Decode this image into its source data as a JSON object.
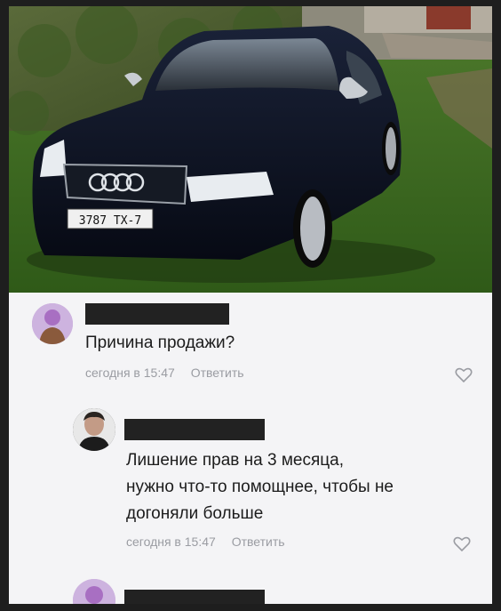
{
  "post": {
    "photo_alt_icon": "car-photo",
    "license_plate": "3787 TX-7"
  },
  "comments": [
    {
      "text": "Причина продажи?",
      "time": "сегодня в 15:47",
      "reply_label": "Ответить",
      "like_icon": "heart-outline-icon"
    },
    {
      "text_lines": [
        "Лишение прав на 3 месяца,",
        "нужно что-то помощнее, чтобы не",
        "догоняли больше"
      ],
      "time": "сегодня в 15:47",
      "reply_label": "Ответить",
      "like_icon": "heart-outline-icon"
    }
  ]
}
